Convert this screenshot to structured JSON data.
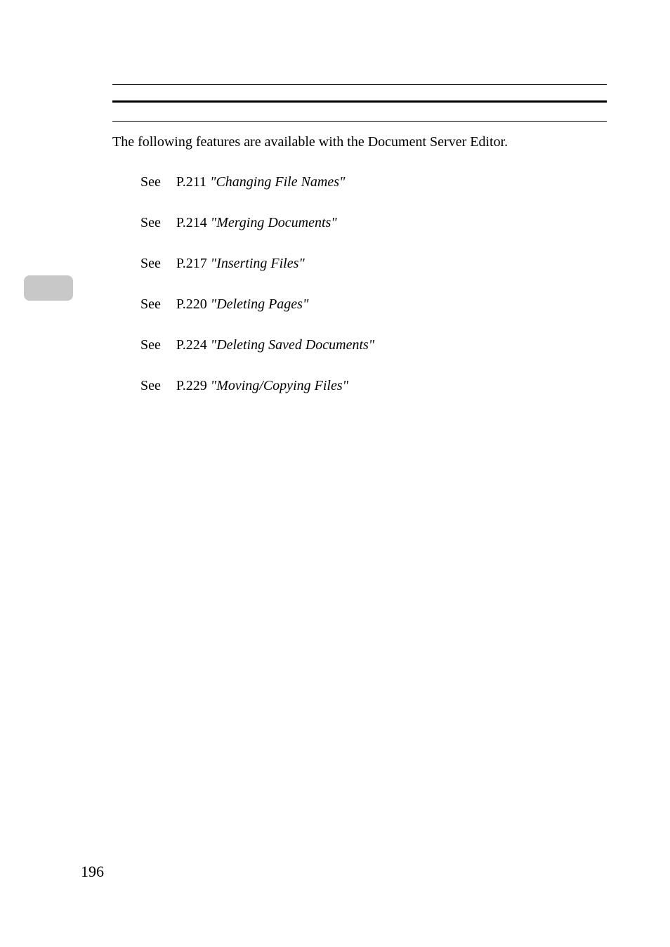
{
  "intro": "The following features are available with the Document Server Editor.",
  "refs": [
    {
      "see": "See",
      "page": "P.211",
      "title": "\"Changing File Names\""
    },
    {
      "see": "See",
      "page": "P.214",
      "title": "\"Merging Documents\""
    },
    {
      "see": "See",
      "page": "P.217",
      "title": "\"Inserting Files\""
    },
    {
      "see": "See",
      "page": "P.220",
      "title": "\"Deleting Pages\""
    },
    {
      "see": "See",
      "page": "P.224",
      "title": "\"Deleting Saved Documents\""
    },
    {
      "see": "See",
      "page": "P.229",
      "title": "\"Moving/Copying Files\""
    }
  ],
  "pageNumber": "196"
}
